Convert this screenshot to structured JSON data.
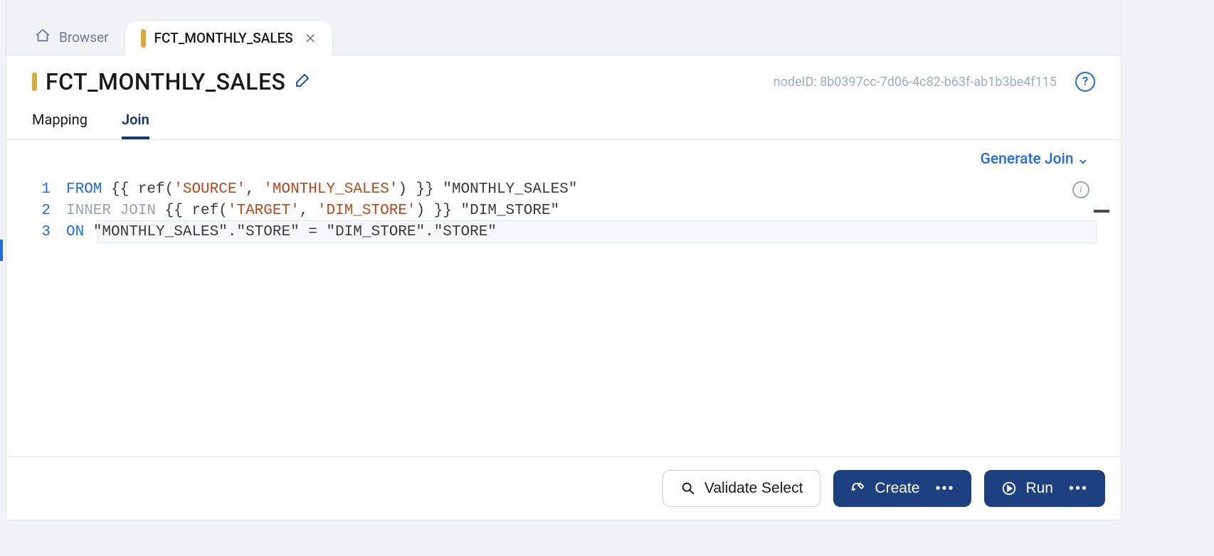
{
  "tabs": {
    "browser_label": "Browser",
    "active_label": "FCT_MONTHLY_SALES"
  },
  "header": {
    "title": "FCT_MONTHLY_SALES",
    "node_id_label": "nodeID: 8b0397cc-7d06-4c82-b63f-ab1b3be4f115"
  },
  "subtabs": {
    "mapping": "Mapping",
    "join": "Join"
  },
  "editor": {
    "generate_join_label": "Generate Join",
    "line_numbers": [
      "1",
      "2",
      "3"
    ],
    "code": {
      "l1": {
        "kw": "FROM",
        "body1": " {{ ref(",
        "str1": "'SOURCE'",
        "body2": ", ",
        "str2": "'MONTHLY_SALES'",
        "body3": ") }} \"MONTHLY_SALES\""
      },
      "l2": {
        "kw": "INNER JOIN",
        "body1": " {{ ref(",
        "str1": "'TARGET'",
        "body2": ", ",
        "str2": "'DIM_STORE'",
        "body3": ") }} \"DIM_STORE\""
      },
      "l3": {
        "kw": "ON",
        "body": " \"MONTHLY_SALES\".\"STORE\" = \"DIM_STORE\".\"STORE\""
      }
    }
  },
  "footer": {
    "validate_label": "Validate Select",
    "create_label": "Create",
    "run_label": "Run"
  }
}
